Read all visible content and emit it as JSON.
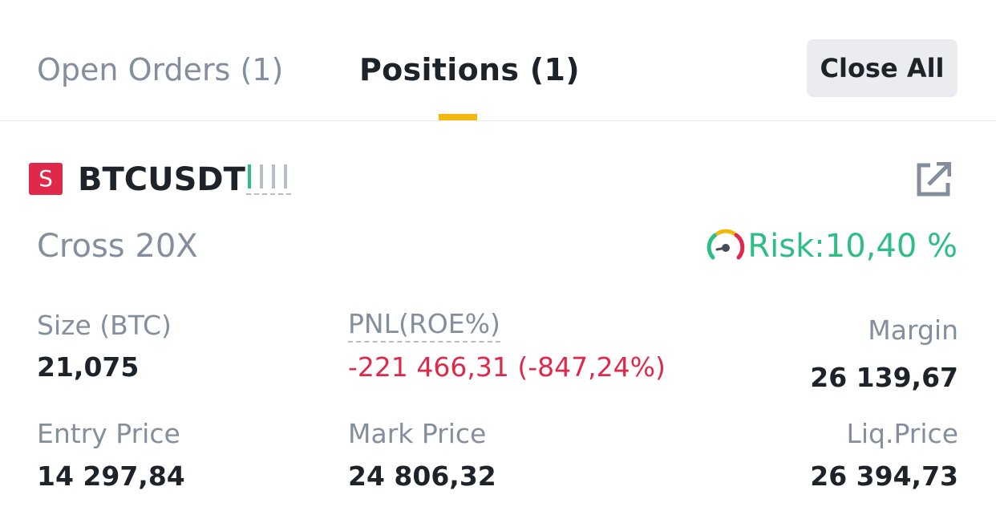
{
  "tabs": {
    "open_orders": "Open Orders (1)",
    "positions": "Positions  (1)"
  },
  "actions": {
    "close_all": "Close All"
  },
  "position": {
    "side_badge": "S",
    "symbol": "BTCUSDT",
    "margin_mode": "Cross 20X",
    "risk": "Risk:10,40 %",
    "size_label": "Size (BTC)",
    "size_value": "21,075",
    "pnl_label": "PNL(ROE%)",
    "pnl_value": "-221 466,31 (-847,24%)",
    "margin_label": "Margin",
    "margin_value": "26 139,67",
    "entry_label": "Entry Price",
    "entry_value": "14 297,84",
    "mark_label": "Mark Price",
    "mark_value": "24 806,32",
    "liq_label": "Liq.Price",
    "liq_value": "26 394,73"
  },
  "colors": {
    "accent": "#f0b90b",
    "negative": "#e0294a",
    "positive": "#2ebd85",
    "muted": "#848e9c"
  },
  "icons": {
    "signal_bars": "signal-bars-icon",
    "share": "share-external-icon",
    "risk_gauge": "risk-gauge-icon"
  }
}
